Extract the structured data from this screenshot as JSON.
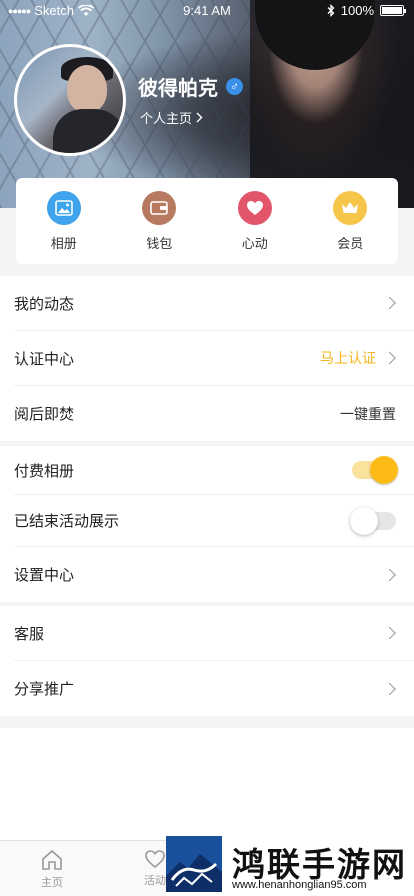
{
  "status_bar": {
    "carrier": "Sketch",
    "time": "9:41 AM",
    "battery": "100%"
  },
  "profile": {
    "name": "彼得帕克",
    "gender_symbol": "♂",
    "homepage_link": "个人主页"
  },
  "quick_menu": [
    {
      "label": "相册",
      "icon": "photo-album-icon",
      "color": "#3ea5ec"
    },
    {
      "label": "钱包",
      "icon": "wallet-icon",
      "color": "#b77a60"
    },
    {
      "label": "心动",
      "icon": "heart-icon",
      "color": "#e2556b"
    },
    {
      "label": "会员",
      "icon": "crown-icon",
      "color": "#f6c64a"
    }
  ],
  "menu": {
    "my_posts": "我的动态",
    "verification": "认证中心",
    "verify_action": "马上认证",
    "burn_after_reading": "阅后即焚",
    "one_key_reset": "一键重置",
    "paid_album": "付费相册",
    "paid_album_on": true,
    "ended_activities": "已结束活动展示",
    "ended_activities_on": false,
    "settings": "设置中心",
    "customer_service": "客服",
    "share": "分享推广"
  },
  "tabbar": [
    {
      "label": "主页",
      "icon": "home-icon"
    },
    {
      "label": "活动",
      "icon": "heart-outline-icon"
    }
  ],
  "watermark": {
    "title": "鸿联手游网",
    "url": "www.henanhonglian95.com"
  },
  "colors": {
    "accent": "#fcbb17",
    "link_blue": "#3a8fe6"
  }
}
